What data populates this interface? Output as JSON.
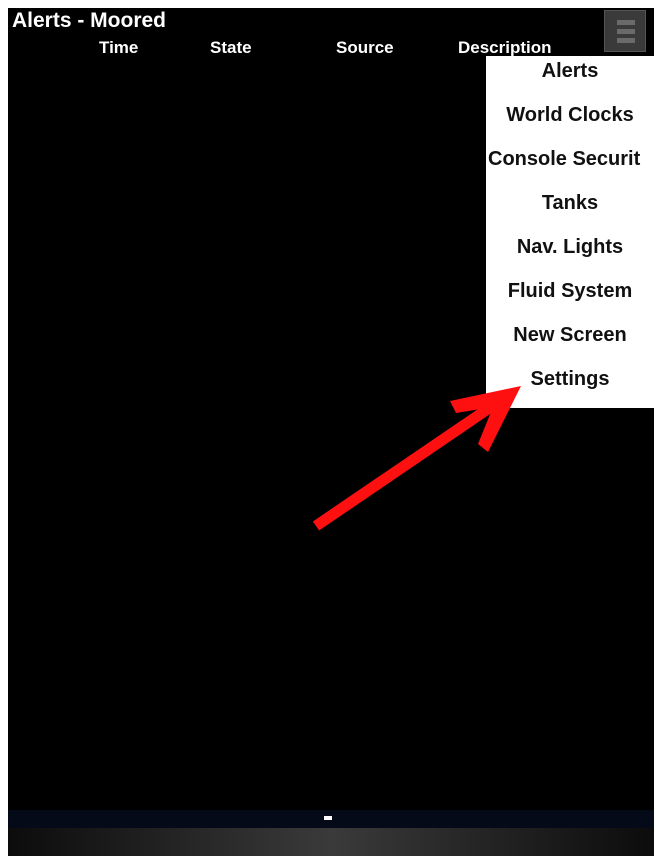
{
  "app": {
    "title": "Alerts - Moored"
  },
  "table": {
    "columns": [
      "Time",
      "State",
      "Source",
      "Description"
    ]
  },
  "menu": {
    "items": [
      "Alerts",
      "World Clocks",
      "Console Securit",
      "Tanks",
      "Nav. Lights",
      "Fluid System",
      "New Screen",
      "Settings"
    ]
  },
  "status": {
    "indicator": "-"
  },
  "colors": {
    "background": "#000000",
    "menu_background": "#ffffff",
    "annotation_arrow": "#ff1010"
  },
  "icons": {
    "menu_button": "hamburger-menu-icon",
    "annotation": "red-arrow-annotation"
  }
}
